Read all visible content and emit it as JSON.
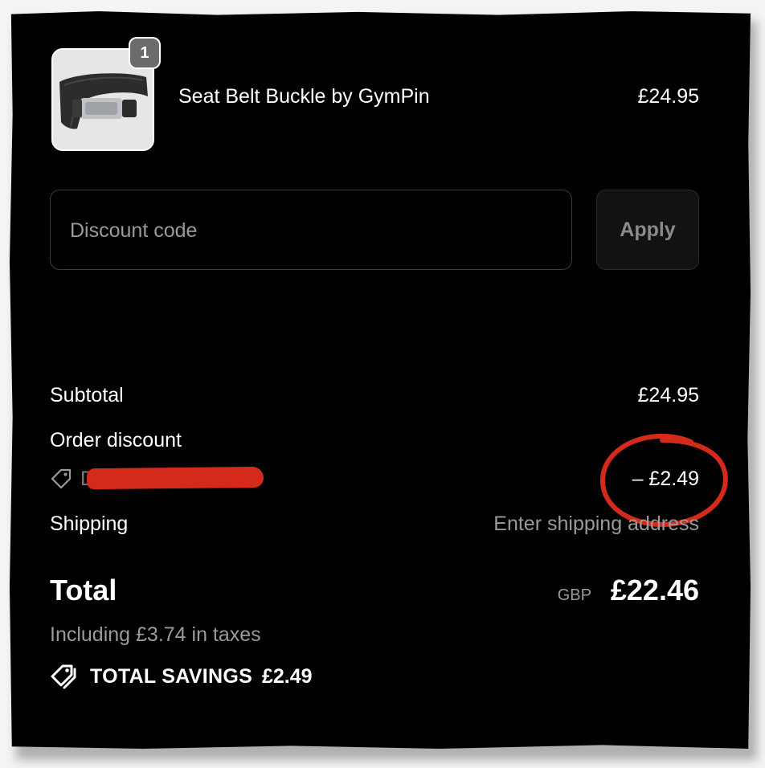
{
  "product": {
    "title": "Seat Belt Buckle by GymPin",
    "price": "£24.95",
    "quantity": "1",
    "image_icon": "seat-belt-buckle-image"
  },
  "discount": {
    "placeholder": "Discount code",
    "apply_label": "Apply"
  },
  "summary": {
    "subtotal_label": "Subtotal",
    "subtotal_value": "£24.95",
    "order_discount_label": "Order discount",
    "discount_code_prefix": "D",
    "discount_value": "– £2.49",
    "shipping_label": "Shipping",
    "shipping_value": "Enter shipping address"
  },
  "total": {
    "label": "Total",
    "currency": "GBP",
    "amount": "£22.46",
    "tax_note": "Including £3.74 in taxes",
    "savings_label": "TOTAL SAVINGS",
    "savings_amount": "£2.49"
  },
  "colors": {
    "background": "#000000",
    "text": "#ffffff",
    "muted": "#9a9a9a",
    "annotation_red": "#d42a1c"
  },
  "icons": {
    "discount_tag": "tag-icon",
    "savings_tag": "tags-icon"
  }
}
